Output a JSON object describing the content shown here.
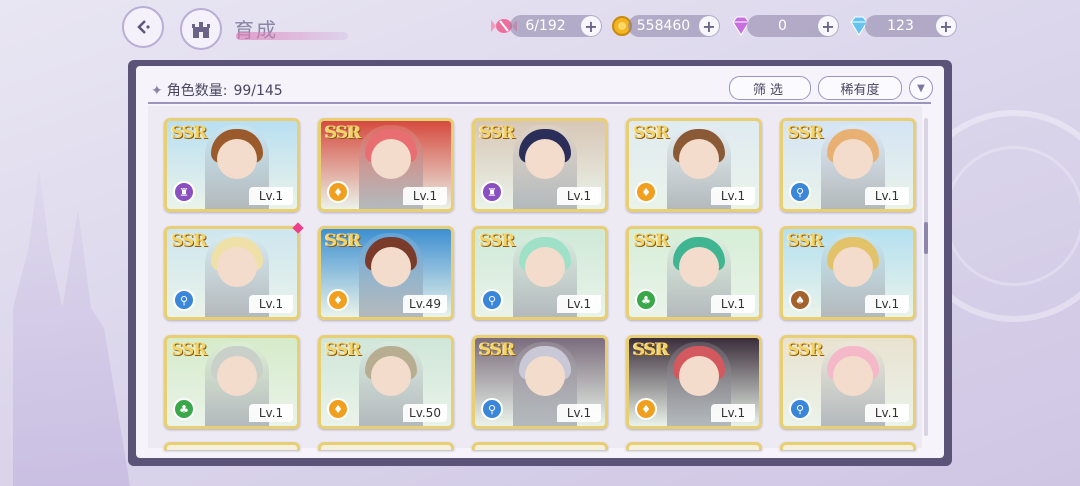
{
  "header": {
    "title": "育成",
    "resources": [
      {
        "icon": "candy-icon",
        "value": "6/192"
      },
      {
        "icon": "gold-coin-icon",
        "value": "558460"
      },
      {
        "icon": "pink-gem-icon",
        "value": "0"
      },
      {
        "icon": "blue-diamond-icon",
        "value": "123"
      }
    ]
  },
  "toolbar": {
    "count_label": "角色数量:",
    "count_value": "99/145",
    "filter_label": "筛选",
    "rarity_label": "稀有度"
  },
  "colors": {
    "panel_frame": "#5b5478",
    "card_border": "#e9cf73",
    "type_purple": "#8a4fc0",
    "type_orange": "#f0a01e",
    "type_blue": "#3a86d9",
    "type_green": "#3aa84a",
    "type_brown": "#a5612b",
    "new_marker": "#ee3f8a"
  },
  "cards": [
    {
      "rarity": "SSR",
      "type": "purple",
      "level": "Lv.1",
      "hair": "#9b5a2b",
      "bg": "#b9dff2"
    },
    {
      "rarity": "SSR",
      "type": "orange",
      "level": "Lv.1",
      "hair": "#e86e72",
      "bg": "#d64a3e"
    },
    {
      "rarity": "SSR",
      "type": "purple",
      "level": "Lv.1",
      "hair": "#2c2e5a",
      "bg": "#d8c7b6"
    },
    {
      "rarity": "SSR",
      "type": "orange",
      "level": "Lv.1",
      "hair": "#8a5a36",
      "bg": "#e0ebf1"
    },
    {
      "rarity": "SSR",
      "type": "blue",
      "level": "Lv.1",
      "hair": "#e8b173",
      "bg": "#d4e4f4"
    },
    {
      "rarity": "SSR",
      "type": "blue",
      "level": "Lv.1",
      "hair": "#efe0a8",
      "bg": "#cde6ef"
    },
    {
      "rarity": "SSR",
      "type": "orange",
      "level": "Lv.49",
      "hair": "#7a3b2b",
      "bg": "#3d8fd1"
    },
    {
      "rarity": "SSR",
      "type": "blue",
      "level": "Lv.1",
      "hair": "#9fe0c9",
      "bg": "#cfe9d8"
    },
    {
      "rarity": "SSR",
      "type": "green",
      "level": "Lv.1",
      "hair": "#3fb592",
      "bg": "#d6eed7"
    },
    {
      "rarity": "SSR",
      "type": "brown",
      "level": "Lv.1",
      "hair": "#e3c36a",
      "bg": "#b4e0f0"
    },
    {
      "rarity": "SSR",
      "type": "green",
      "level": "Lv.1",
      "hair": "#c9cfc9",
      "bg": "#d5ebc9"
    },
    {
      "rarity": "SSR",
      "type": "orange",
      "level": "Lv.50",
      "hair": "#b7ae92",
      "bg": "#cfe6d8"
    },
    {
      "rarity": "SSR",
      "type": "blue",
      "level": "Lv.1",
      "hair": "#c9c8d6",
      "bg": "#7a6c7c"
    },
    {
      "rarity": "SSR",
      "type": "orange",
      "level": "Lv.1",
      "hair": "#d4595e",
      "bg": "#3a2d3a"
    },
    {
      "rarity": "SSR",
      "type": "blue",
      "level": "Lv.1",
      "hair": "#f4b8c8",
      "bg": "#e9e2d0"
    }
  ]
}
